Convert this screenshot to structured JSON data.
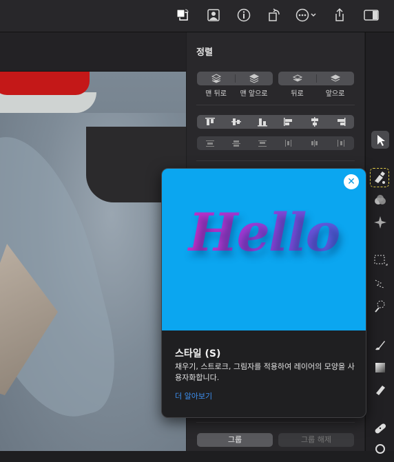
{
  "toolbar": {
    "icons": [
      "fill-stroke-swap-icon",
      "person-icon",
      "info-icon",
      "rotate-icon",
      "more-icon",
      "share-icon",
      "sidebar-icon"
    ]
  },
  "panel": {
    "title": "정렬",
    "arrange_labels": [
      "맨 뒤로",
      "맨 앞으로",
      "뒤로",
      "앞으로"
    ],
    "group_button": "그룹",
    "ungroup_button": "그룹 해제"
  },
  "popover": {
    "hello_text": "Hello",
    "title": "스타일 (S)",
    "description": "채우기, 스트로크, 그림자를 적용하여 레이어의 모양을 사용자화합니다.",
    "link": "더 알아보기"
  },
  "colors": {
    "accent_link": "#3d8ff0",
    "popover_image_bg": "#0ba6f0",
    "selected_tool_outline": "#e8d34a"
  }
}
